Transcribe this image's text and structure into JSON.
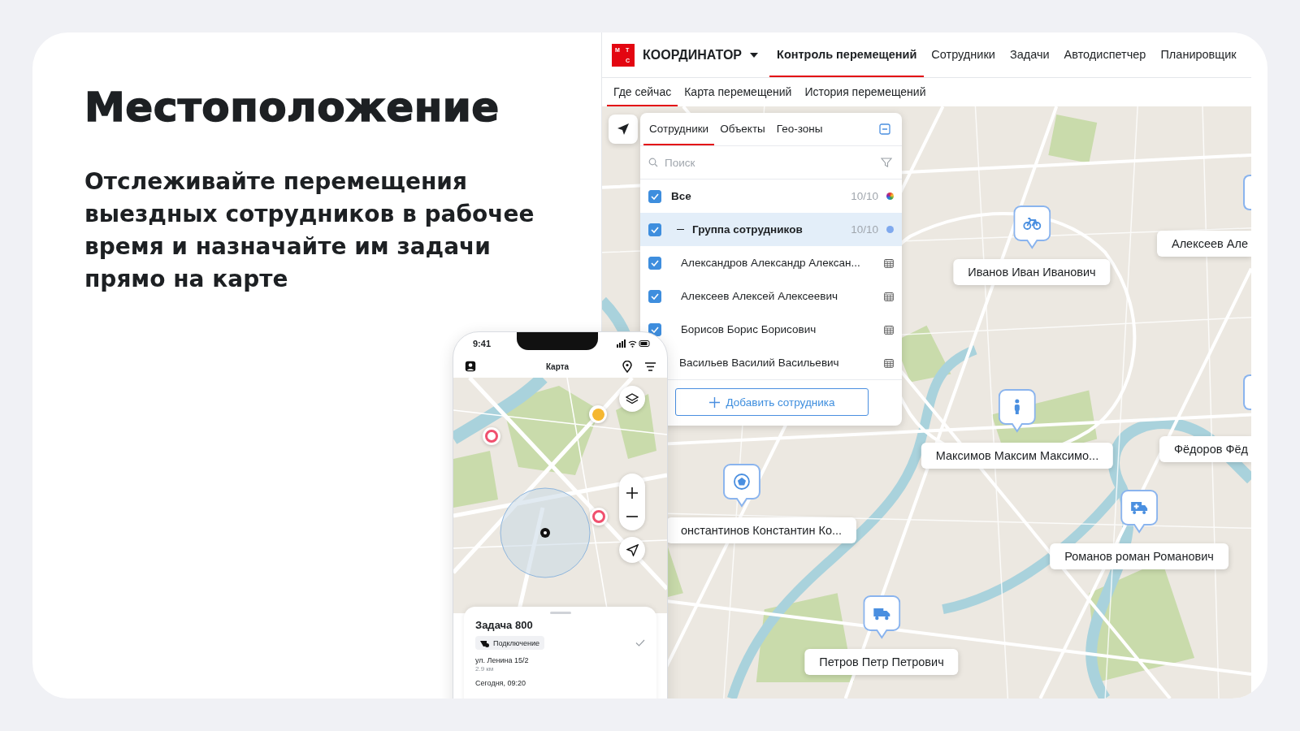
{
  "hero": {
    "title": "Местоположение",
    "description": "Отслеживайте перемещения выездных сотрудников в рабочее время и назначайте им задачи прямо на карте"
  },
  "app": {
    "brand": {
      "logo_letters": [
        "М",
        "Т",
        "С"
      ],
      "name": "КООРДИНАТОР"
    },
    "nav": [
      {
        "label": "Контроль перемещений",
        "selected": true
      },
      {
        "label": "Сотрудники",
        "selected": false
      },
      {
        "label": "Задачи",
        "selected": false
      },
      {
        "label": "Автодиспетчер",
        "selected": false
      },
      {
        "label": "Планировщик",
        "selected": false
      }
    ],
    "subnav": [
      {
        "label": "Где сейчас",
        "selected": true
      },
      {
        "label": "Карта перемещений",
        "selected": false
      },
      {
        "label": "История перемещений",
        "selected": false
      }
    ],
    "panel": {
      "tabs": [
        {
          "label": "Сотрудники",
          "selected": true
        },
        {
          "label": "Объекты",
          "selected": false
        },
        {
          "label": "Гео-зоны",
          "selected": false
        }
      ],
      "search": {
        "placeholder": "Поиск"
      },
      "rows": [
        {
          "kind": "all",
          "label": "Все",
          "count": "10/10",
          "checked": true,
          "selected": false
        },
        {
          "kind": "group",
          "label": "Группа сотрудников",
          "count": "10/10",
          "checked": true,
          "selected": true,
          "expanded": true
        },
        {
          "kind": "employee",
          "label": "Александров Александр Алексан...",
          "checked": true,
          "selected": false
        },
        {
          "kind": "employee",
          "label": "Алексеев Алексей Алексеевич",
          "checked": true,
          "selected": false
        },
        {
          "kind": "employee",
          "label": "Борисов Борис Борисович",
          "checked": true,
          "selected": false
        },
        {
          "kind": "employee",
          "label": "Васильев Василий Васильевич",
          "selected": false
        }
      ],
      "add_button": "Добавить сотрудника"
    },
    "map_markers": [
      {
        "name": "Иванов Иван Иванович",
        "kind": "bicycle"
      },
      {
        "name": "Алексеев Але",
        "kind": "cut"
      },
      {
        "name": "Максимов Максим Максимо...",
        "kind": "person"
      },
      {
        "name": "Фёдоров Фёд",
        "kind": "cut"
      },
      {
        "name": "онстантинов Константин Ко...",
        "kind": "football"
      },
      {
        "name": "Романов роман Романович",
        "kind": "ambulance"
      },
      {
        "name": "Петров Петр Петрович",
        "kind": "truck"
      }
    ]
  },
  "phone": {
    "time": "9:41",
    "title": "Карта",
    "map_pins": [
      {
        "kind": "ring",
        "color": "#f0506e"
      },
      {
        "kind": "dot",
        "color": "#f5b731"
      },
      {
        "kind": "ring",
        "color": "#f0506e"
      }
    ],
    "task": {
      "title": "Задача 800",
      "tag": "Подключение",
      "done": true,
      "address": "ул. Ленина 15/2",
      "distance": "2.9 км",
      "time": "Сегодня, 09:20"
    }
  }
}
